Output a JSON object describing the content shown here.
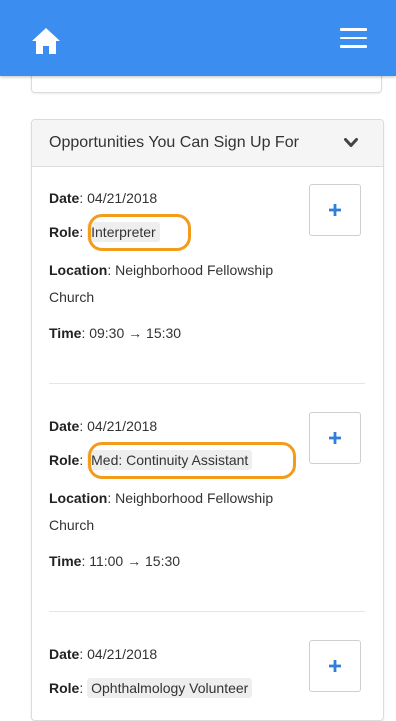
{
  "colors": {
    "navbar": "#3b8def",
    "highlight": "#f39c1c",
    "add_icon": "#2f7fd8"
  },
  "navbar": {
    "home_icon": "home-icon",
    "menu_icon": "hamburger-menu-icon"
  },
  "panel": {
    "title": "Opportunities You Can Sign Up For",
    "toggle_icon": "chevron-down-icon"
  },
  "opportunities": [
    {
      "date_label": "Date",
      "date": ": 04/21/2018",
      "role_label": "Role",
      "role": "Interpreter",
      "location_label": "Location",
      "location_line1": ": Neighborhood Fellowship",
      "location_line2": "Church",
      "time_label": "Time",
      "time": ": 09:30 → 15:30",
      "add_icon": "plus-icon"
    },
    {
      "date_label": "Date",
      "date": ": 04/21/2018",
      "role_label": "Role",
      "role": "Med: Continuity Assistant",
      "location_label": "Location",
      "location_line1": ": Neighborhood Fellowship",
      "location_line2": "Church",
      "time_label": "Time",
      "time": ": 11:00 → 15:30",
      "add_icon": "plus-icon"
    },
    {
      "date_label": "Date",
      "date": ": 04/21/2018",
      "role_label": "Role",
      "role": "Ophthalmology Volunteer",
      "add_icon": "plus-icon"
    }
  ]
}
